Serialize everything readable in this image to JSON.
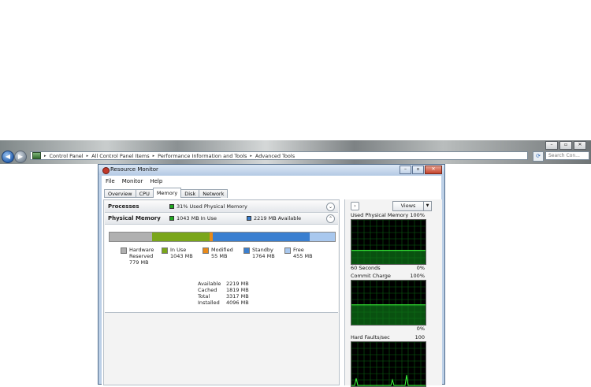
{
  "explorer": {
    "breadcrumbs": [
      "Control Panel",
      "All Control Panel Items",
      "Performance Information and Tools",
      "Advanced Tools"
    ],
    "search_placeholder": "Search Con...",
    "window_buttons": [
      "–",
      "▫",
      "✕"
    ]
  },
  "resource_monitor": {
    "title": "Resource Monitor",
    "menu": [
      "File",
      "Monitor",
      "Help"
    ],
    "tabs": [
      "Overview",
      "CPU",
      "Memory",
      "Disk",
      "Network"
    ],
    "active_tab": "Memory",
    "processes": {
      "title": "Processes",
      "summary": "31% Used Physical Memory",
      "indicator_color": "#1faa1f"
    },
    "physical_memory": {
      "title": "Physical Memory",
      "summary_in_use": "1043 MB In Use",
      "summary_available": "2219 MB Available",
      "bar_segments_mb": {
        "hardware_reserved": 779,
        "in_use": 1043,
        "modified": 55,
        "standby": 1764,
        "free": 455
      },
      "legend": [
        {
          "label": "Hardware",
          "label2": "Reserved",
          "value": "779 MB",
          "color": "#b0b0b0"
        },
        {
          "label": "In Use",
          "label2": "",
          "value": "1043 MB",
          "color": "#7aa61a"
        },
        {
          "label": "Modified",
          "label2": "",
          "value": "55 MB",
          "color": "#e98a19"
        },
        {
          "label": "Standby",
          "label2": "",
          "value": "1764 MB",
          "color": "#3a7fd0"
        },
        {
          "label": "Free",
          "label2": "",
          "value": "455 MB",
          "color": "#a9c8ee"
        }
      ],
      "stats": [
        {
          "label": "Available",
          "value": "2219 MB"
        },
        {
          "label": "Cached",
          "value": "1819 MB"
        },
        {
          "label": "Total",
          "value": "3317 MB"
        },
        {
          "label": "Installed",
          "value": "4096 MB"
        }
      ]
    },
    "right_pane": {
      "views_label": "Views",
      "graphs": [
        {
          "title": "Used Physical Memory",
          "max": "100%",
          "footer_left": "60 Seconds",
          "footer_right": "0%"
        },
        {
          "title": "Commit Charge",
          "max": "100%",
          "footer_left": "",
          "footer_right": "0%"
        },
        {
          "title": "Hard Faults/sec",
          "max": "100",
          "footer_left": "",
          "footer_right": ""
        }
      ]
    }
  }
}
